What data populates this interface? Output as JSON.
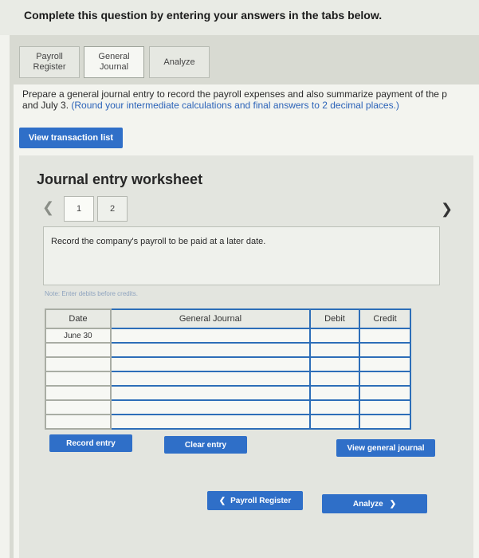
{
  "instruction": "Complete this question by entering your answers in the tabs below.",
  "tabs": [
    {
      "line1": "Payroll",
      "line2": "Register"
    },
    {
      "line1": "General",
      "line2": "Journal"
    },
    {
      "label": "Analyze"
    }
  ],
  "prompt": {
    "line1": "Prepare a general journal entry to record the payroll expenses and also summarize payment of the p",
    "line2_start": "and July 3. ",
    "line2_blue": "(Round your intermediate calculations and final answers to 2 decimal places.)"
  },
  "view_transaction_list": "View transaction list",
  "worksheet": {
    "title": "Journal entry worksheet",
    "pages": [
      "1",
      "2"
    ],
    "description": "Record the company's payroll to be paid at a later date.",
    "note": "Note: Enter debits before credits.",
    "columns": {
      "date": "Date",
      "account": "General Journal",
      "debit": "Debit",
      "credit": "Credit"
    },
    "first_date": "June 30"
  },
  "buttons": {
    "record": "Record entry",
    "clear": "Clear entry",
    "view_journal": "View general journal",
    "prev": "Payroll Register",
    "next": "Analyze"
  },
  "colors": {
    "accent": "#2f6fc8"
  }
}
